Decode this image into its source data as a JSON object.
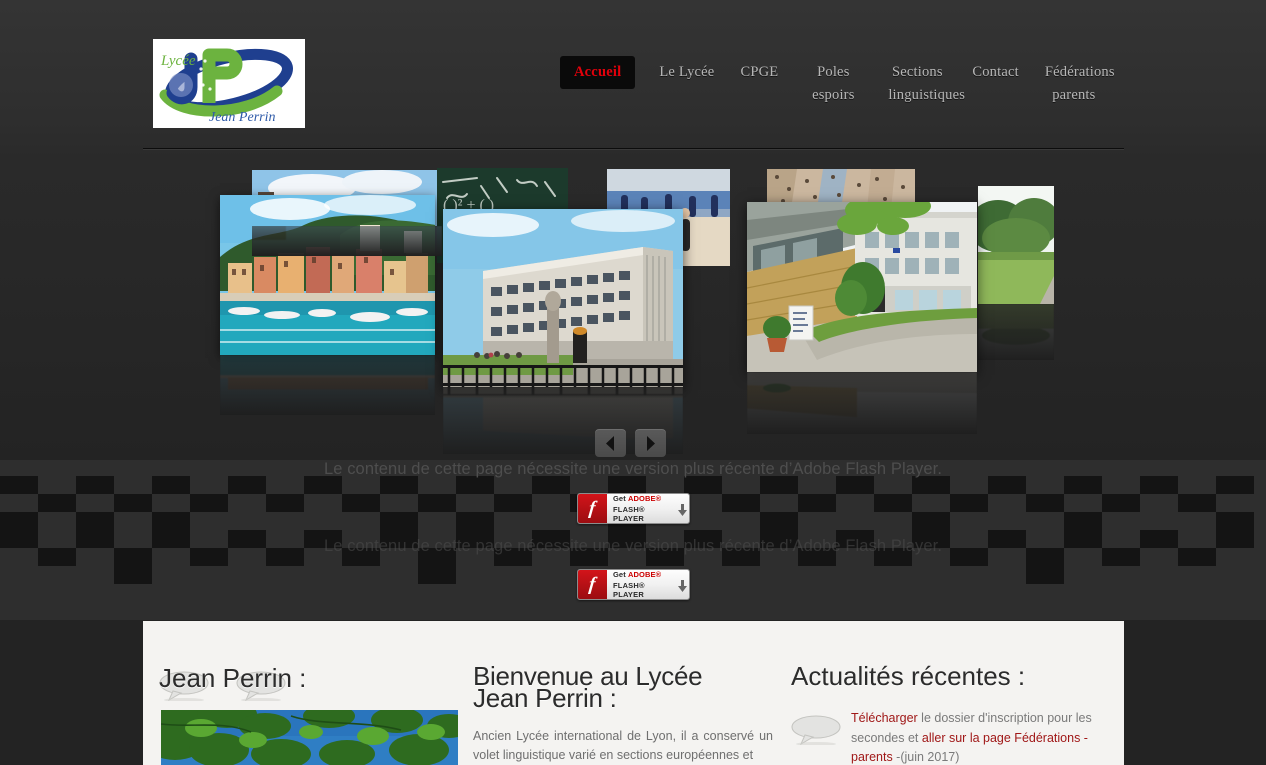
{
  "site": {
    "logo": {
      "line1": "Lycée",
      "initials": "JP",
      "line2": "Jean Perrin",
      "alt": "Lycée Jean Perrin logo"
    }
  },
  "nav": {
    "items": [
      {
        "label": "Accueil",
        "active": true
      },
      {
        "label": "Le Lycée",
        "active": false
      },
      {
        "label": "CPGE",
        "active": false
      },
      {
        "label": "Poles espoirs",
        "active": false
      },
      {
        "label": "Sections linguistiques",
        "active": false
      },
      {
        "label": "Contact",
        "active": false
      },
      {
        "label": "Fédérations parents",
        "active": false
      }
    ]
  },
  "carousel": {
    "prev_label": "‹",
    "next_label": "›",
    "slides": [
      {
        "name": "slide-rooftop",
        "caption": ""
      },
      {
        "name": "slide-portofino",
        "caption": ""
      },
      {
        "name": "slide-blackboard",
        "caption": ""
      },
      {
        "name": "slide-lycee-facade",
        "caption": ""
      },
      {
        "name": "slide-gymnasium",
        "caption": ""
      },
      {
        "name": "slide-climbing-wall",
        "caption": ""
      },
      {
        "name": "slide-courtyard",
        "caption": ""
      },
      {
        "name": "slide-park",
        "caption": ""
      }
    ]
  },
  "flash": {
    "message": "Le contenu de cette page nécessite une version plus récente d’Adobe Flash Player.",
    "badge": {
      "line1_prefix": "Get ",
      "line1_brand": "ADOBE®",
      "line2": "FLASH® PLAYER"
    }
  },
  "content": {
    "left": {
      "title": "Jean Perrin :"
    },
    "middle": {
      "title_line1": "Bienvenue au Lycée",
      "title_line2": "Jean Perrin :",
      "paragraph": "Ancien Lycée international de Lyon, il a conservé un volet linguistique varié en sections européennes et"
    },
    "right": {
      "title": "Actualités récentes :",
      "news": [
        {
          "link1": "Télécharger",
          "text1": " le dossier d'inscription pour les secondes et ",
          "link2": "aller sur la page Fédérations - parents",
          "text2": " -(juin 2017)"
        }
      ]
    }
  },
  "colors": {
    "accent_red": "#e3000b",
    "link_red": "#a01818",
    "panel_bg": "#f4f3f1",
    "page_bg": "#2b2b2b",
    "nav_text": "#b6b6b6"
  }
}
